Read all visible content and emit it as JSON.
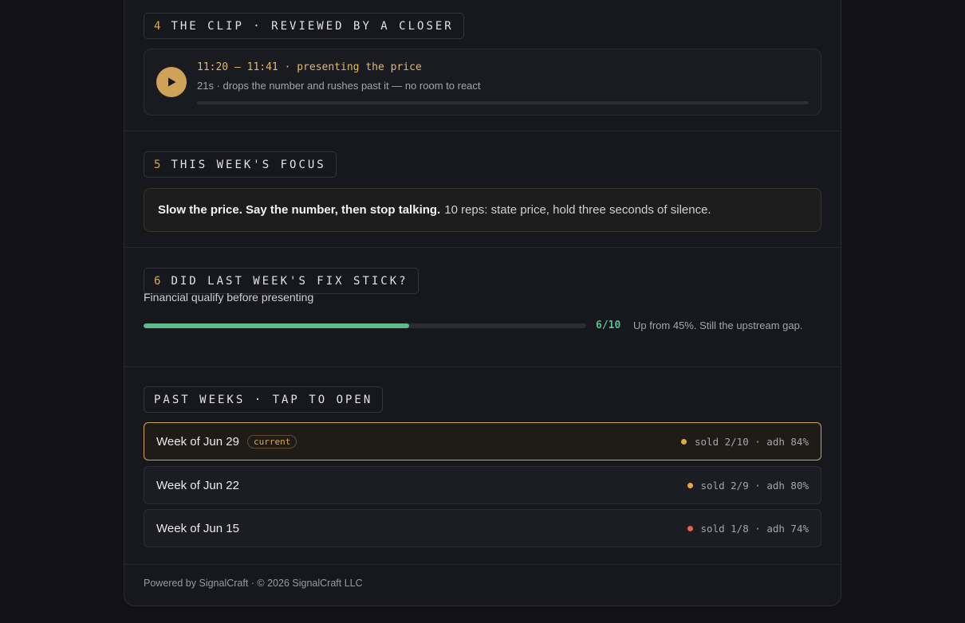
{
  "clip": {
    "number": "4",
    "heading": "THE CLIP · REVIEWED BY A CLOSER",
    "title": "11:20 – 11:41 · presenting the price",
    "subtitle": "21s · drops the number and rushes past it — no room to react",
    "play_icon": "play-icon",
    "progress_fraction": 0
  },
  "focus": {
    "number": "5",
    "heading": "THIS WEEK'S FOCUS",
    "headline": "Slow the price. Say the number, then stop talking.",
    "detail": "10 reps: state price, hold three seconds of silence."
  },
  "fix": {
    "number": "6",
    "heading": "DID LAST WEEK'S FIX STICK?",
    "label": "Financial qualify before presenting",
    "score": "6/10",
    "score_fraction": 0.6,
    "note": "Up from 45%. Still the upstream gap.",
    "bar_color": "#5dbb8a"
  },
  "past_weeks": {
    "heading": "PAST WEEKS · TAP TO OPEN",
    "items": [
      {
        "name": "Week of Jun 29",
        "badge": "current",
        "status_color": "#e0aa4b",
        "stats": "sold 2/10 · adh 84%"
      },
      {
        "name": "Week of Jun 22",
        "badge": "",
        "status_color": "#e0aa4b",
        "stats": "sold 2/9 · adh 80%"
      },
      {
        "name": "Week of Jun 15",
        "badge": "",
        "status_color": "#e0625a",
        "stats": "sold 1/8 · adh 74%"
      }
    ]
  },
  "footer": {
    "text": "Powered by SignalCraft · © 2026 SignalCraft LLC"
  },
  "colors": {
    "accent": "#d8a952",
    "success": "#5dbb8a",
    "danger": "#e0625a"
  }
}
